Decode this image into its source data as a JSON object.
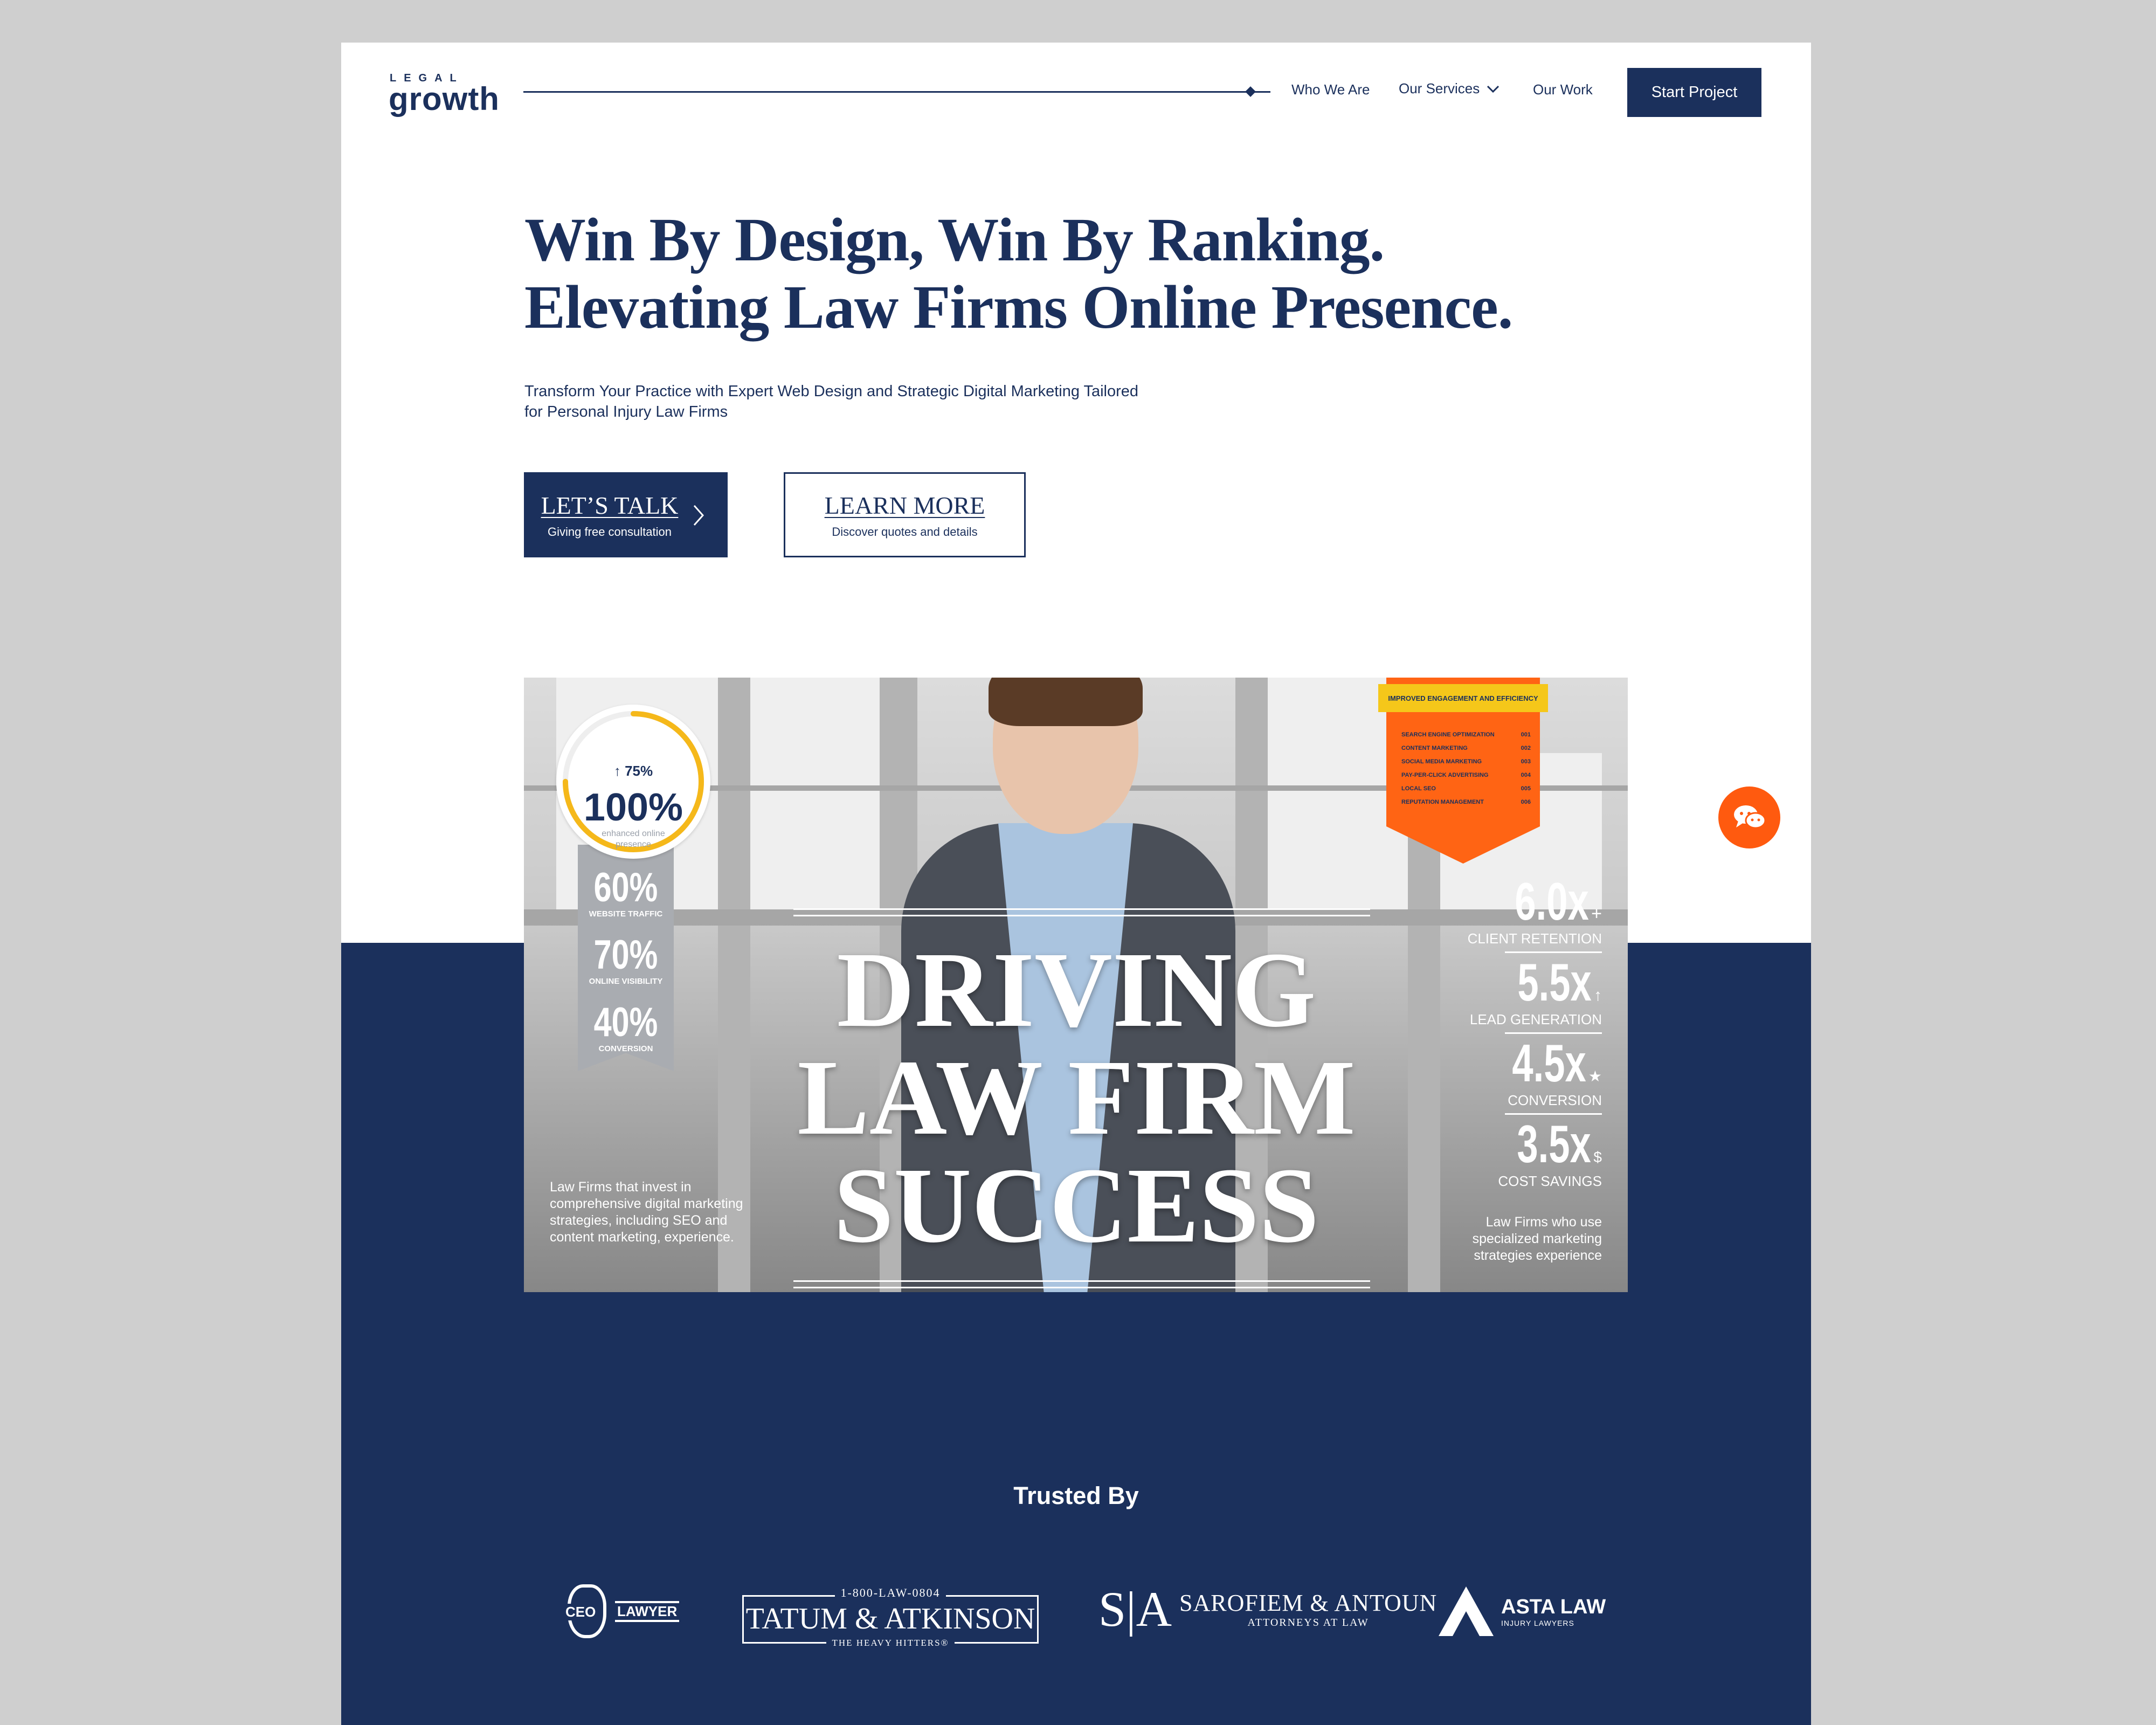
{
  "brand": {
    "small": "LEGAL",
    "big": "growth"
  },
  "nav": {
    "items": [
      "Who We Are",
      "Our Services",
      "Our Work"
    ],
    "cta": "Start Project"
  },
  "hero": {
    "title_line1": "Win By Design, Win By Ranking.",
    "title_line2": "Elevating Law Firms Online Presence.",
    "subtitle_line1": "Transform Your Practice with Expert Web Design and Strategic Digital Marketing Tailored",
    "subtitle_line2": "for Personal Injury Law Firms",
    "primary_cta": {
      "title": "LET’S TALK",
      "desc": "Giving free consultation"
    },
    "secondary_cta": {
      "title": "LEARN MORE",
      "desc": "Discover quotes and details"
    }
  },
  "feature": {
    "headline": [
      "DRIVING",
      "LAW FIRM",
      "SUCCESS"
    ],
    "badge": {
      "delta": "↑ 75%",
      "value": "100%",
      "label_line1": "enhanced online",
      "label_line2": "presence",
      "fill": 0.75
    },
    "ribbon_stats": [
      {
        "value": "60%",
        "label": "WEBSITE TRAFFIC"
      },
      {
        "value": "70%",
        "label": "ONLINE VISIBILITY"
      },
      {
        "value": "40%",
        "label": "CONVERSION"
      }
    ],
    "left_caption": "Law Firms that invest in comprehensive digital marketing strategies, including SEO and content marketing, experience.",
    "tag": {
      "label": "IMPROVED ENGAGEMENT AND EFFICIENCY",
      "rows": [
        {
          "name": "SEARCH ENGINE OPTIMIZATION",
          "num": "001"
        },
        {
          "name": "CONTENT MARKETING",
          "num": "002"
        },
        {
          "name": "SOCIAL MEDIA MARKETING",
          "num": "003"
        },
        {
          "name": "PAY-PER-CLICK ADVERTISING",
          "num": "004"
        },
        {
          "name": "LOCAL SEO",
          "num": "005"
        },
        {
          "name": "REPUTATION MANAGEMENT",
          "num": "006"
        }
      ]
    },
    "multipliers": [
      {
        "value": "6.0x",
        "icon": "+",
        "label": "CLIENT RETENTION"
      },
      {
        "value": "5.5x",
        "icon": "↑",
        "label": "LEAD GENERATION"
      },
      {
        "value": "4.5x",
        "icon": "★",
        "label": "CONVERSION"
      },
      {
        "value": "3.5x",
        "icon": "$",
        "label": "COST SAVINGS"
      }
    ],
    "right_caption": "Law Firms who use specialized marketing strategies experience"
  },
  "trusted": {
    "heading": "Trusted By",
    "ceo": {
      "badge": "CEO",
      "text": "LAWYER"
    },
    "tatum": {
      "phone": "1-800-LAW-0804",
      "name": "TATUM & ATKINSON",
      "tagline": "THE HEAVY HITTERS®"
    },
    "saro": {
      "mono": "S|A",
      "name": "SAROFIEM & ANTOUN",
      "sub": "ATTORNEYS AT LAW"
    },
    "asta": {
      "name": "ASTA LAW",
      "sub": "INJURY LAWYERS"
    }
  },
  "colors": {
    "navy": "#1b305c",
    "orange": "#ff5a0f",
    "yellow": "#f5c71a"
  }
}
